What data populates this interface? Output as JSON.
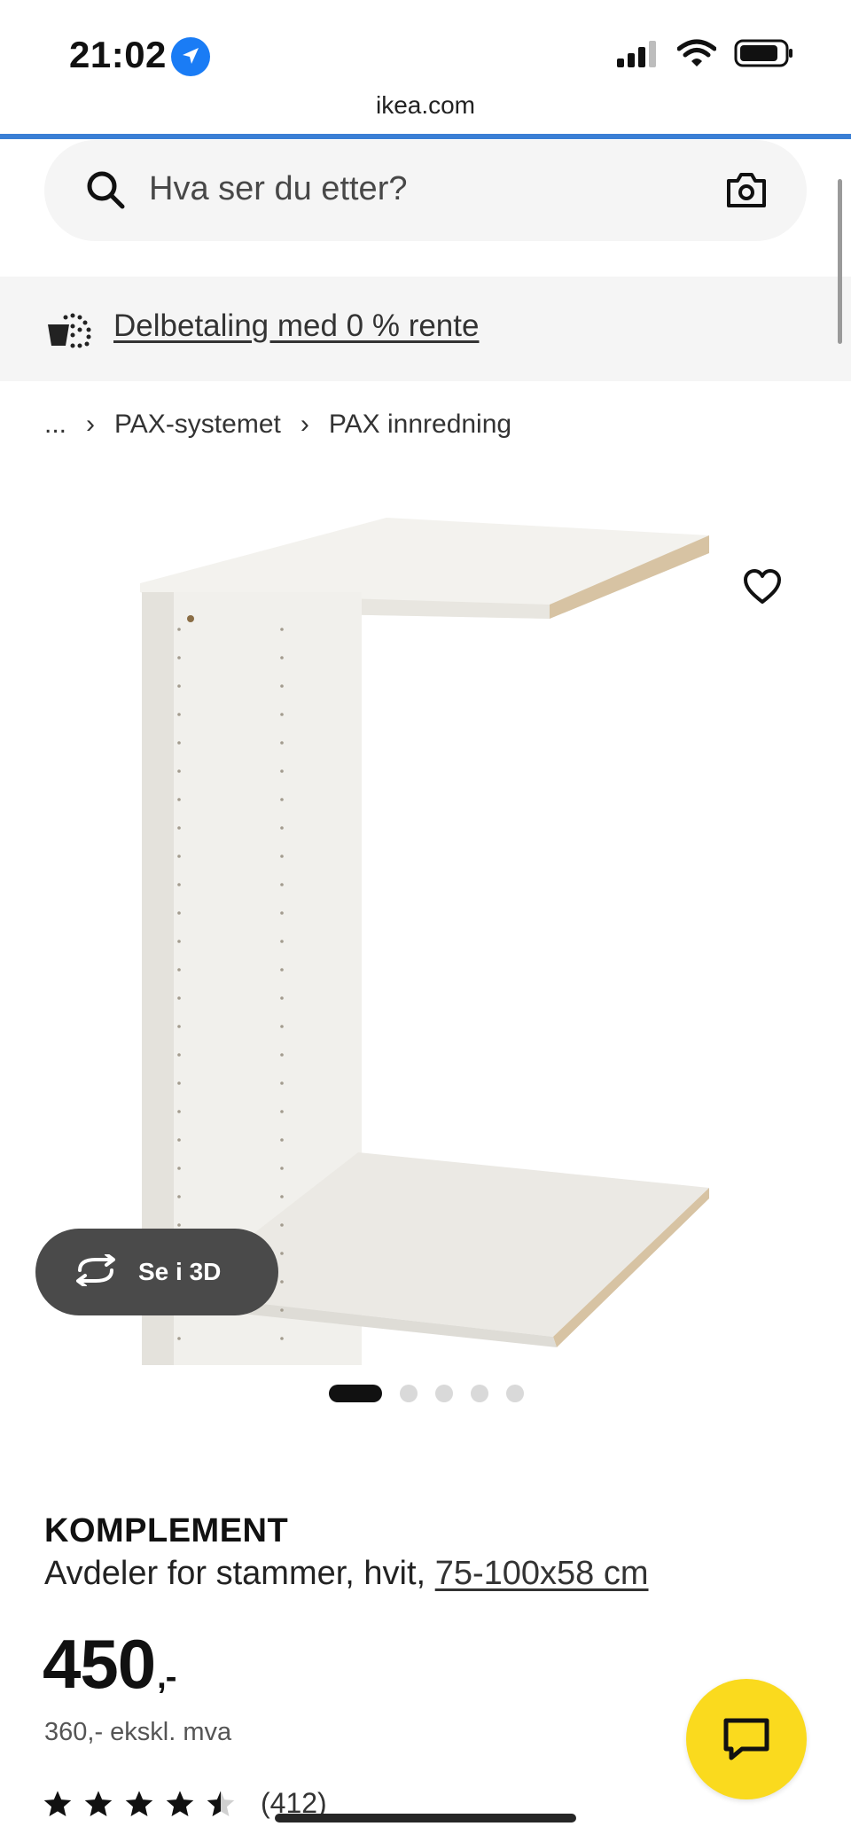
{
  "status_bar": {
    "time": "21:02",
    "url": "ikea.com",
    "icons": [
      "location-arrow-icon",
      "cellular-signal-icon",
      "wifi-icon",
      "battery-icon"
    ]
  },
  "search": {
    "placeholder": "Hva ser du etter?",
    "icons": [
      "search-icon",
      "camera-icon"
    ]
  },
  "banner": {
    "label": "Delbetaling med 0 % rente",
    "icon": "payment-basket-icon"
  },
  "breadcrumb": {
    "items": [
      "...",
      "PAX-systemet",
      "PAX innredning"
    ]
  },
  "gallery": {
    "view_3d_label": "Se i 3D",
    "slide_count": 5,
    "active_slide": 1
  },
  "product": {
    "name": "KOMPLEMENT",
    "description": "Avdeler for stammer, hvit, ",
    "size": "75-100x58 cm",
    "price": "450",
    "price_suffix": ",-",
    "price_ex_vat": "360,- ekskl. mva",
    "rating": 4.5,
    "review_count": "(412)"
  },
  "colors": {
    "accent_blue": "#3a7fd5",
    "chat_yellow": "#fada1e",
    "location_blue": "#1a7cf5"
  }
}
